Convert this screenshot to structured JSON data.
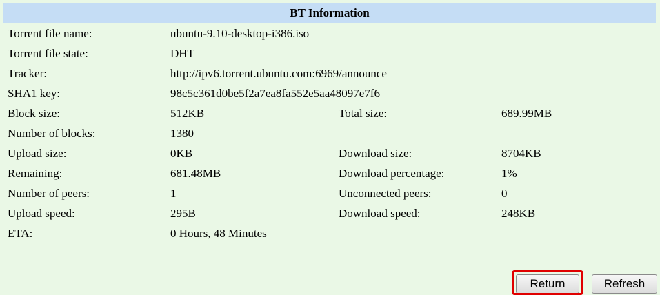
{
  "header": {
    "title": "BT Information"
  },
  "rows": [
    {
      "label": "Torrent file name:",
      "value": "ubuntu-9.10-desktop-i386.iso"
    },
    {
      "label": "Torrent file state:",
      "value": "DHT"
    },
    {
      "label": "Tracker:",
      "value": "http://ipv6.torrent.ubuntu.com:6969/announce"
    },
    {
      "label": "SHA1 key:",
      "value": "98c5c361d0be5f2a7ea8fa552e5aa48097e7f6"
    },
    {
      "label": "Block size:",
      "value": "512KB",
      "label2": "Total size:",
      "value2": "689.99MB"
    },
    {
      "label": "Number of blocks:",
      "value": "1380"
    },
    {
      "label": "Upload size:",
      "value": "0KB",
      "label2": "Download size:",
      "value2": "8704KB"
    },
    {
      "label": "Remaining:",
      "value": "681.48MB",
      "label2": "Download percentage:",
      "value2": "1%"
    },
    {
      "label": "Number of peers:",
      "value": "1",
      "label2": "Unconnected peers:",
      "value2": "0"
    },
    {
      "label": "Upload speed:",
      "value": "295B",
      "label2": "Download speed:",
      "value2": "248KB"
    },
    {
      "label": "ETA:",
      "value": "0 Hours, 48 Minutes"
    }
  ],
  "buttons": {
    "return_label": "Return",
    "refresh_label": "Refresh"
  },
  "colors": {
    "panel_background": "#eaf8e6",
    "header_background": "#c5ddf5",
    "highlight_border": "#e00000"
  }
}
